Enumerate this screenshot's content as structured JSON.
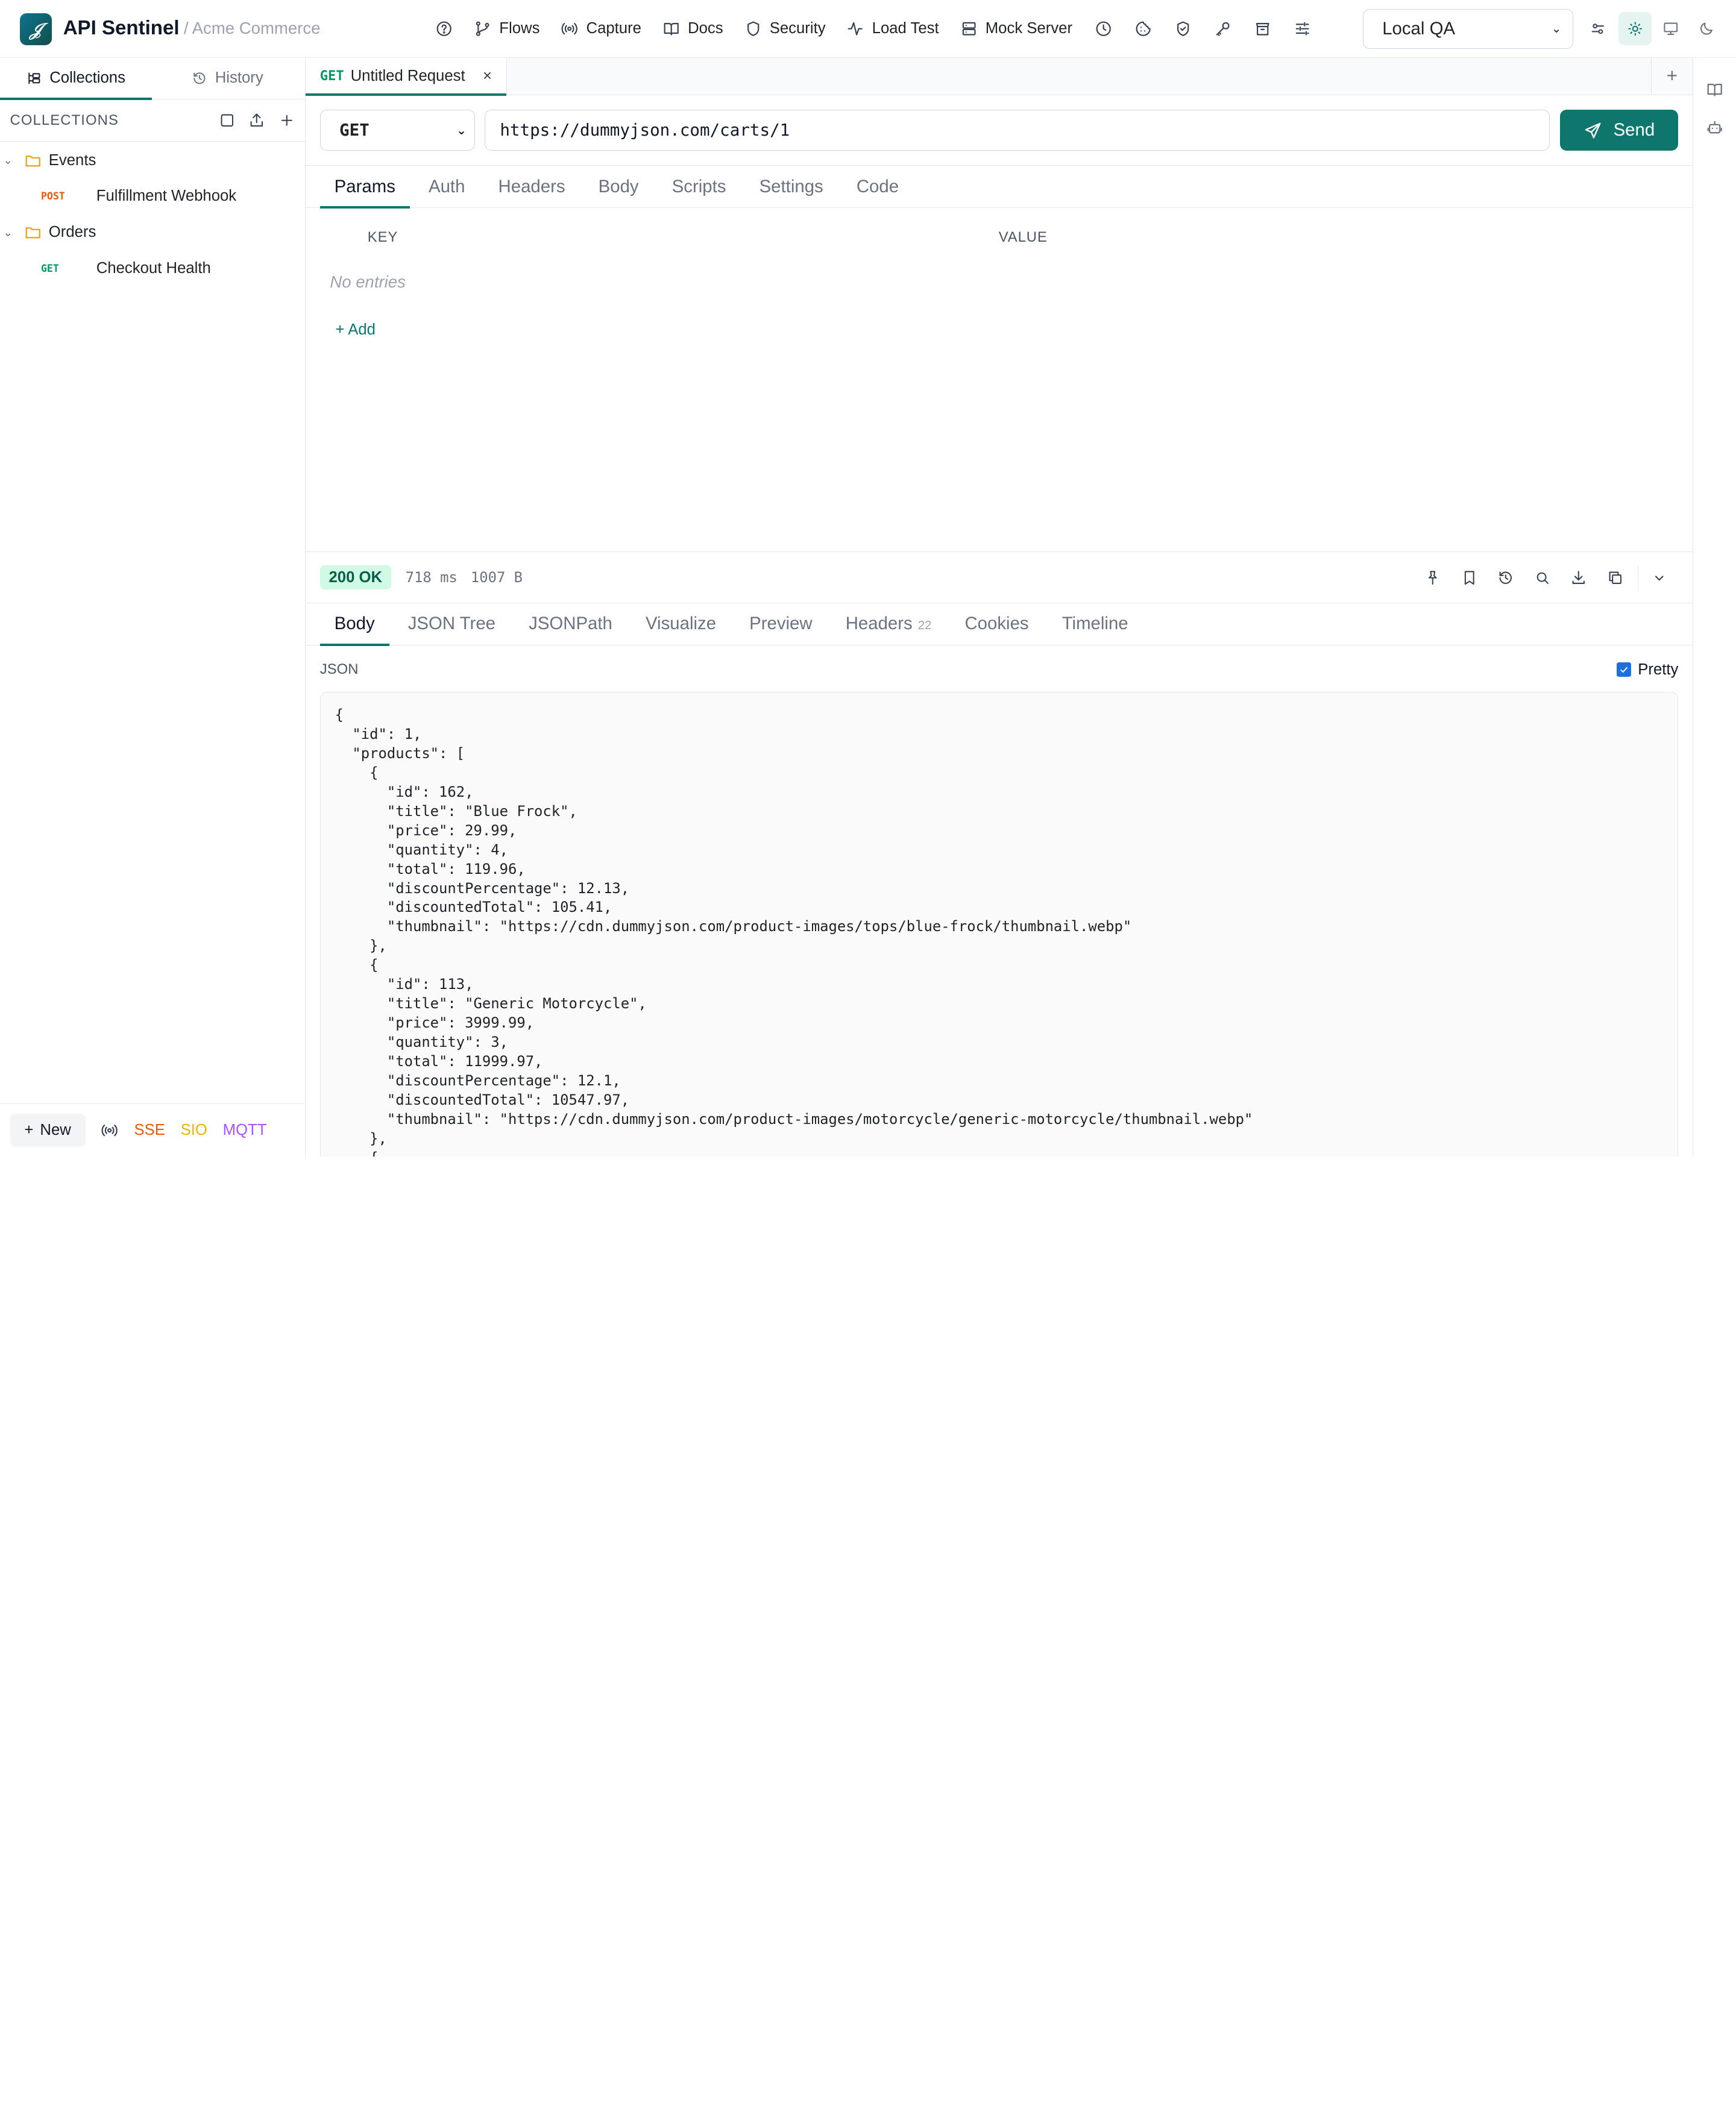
{
  "app": {
    "title": "API Sentinel",
    "workspace": "/ Acme Commerce",
    "logo_glyph": "𝒥"
  },
  "nav": [
    {
      "label": "Flows",
      "icon": "git-branch-icon"
    },
    {
      "label": "Capture",
      "icon": "broadcast-icon"
    },
    {
      "label": "Docs",
      "icon": "book-icon"
    },
    {
      "label": "Security",
      "icon": "shield-icon"
    },
    {
      "label": "Load Test",
      "icon": "activity-icon"
    },
    {
      "label": "Mock Server",
      "icon": "server-icon"
    }
  ],
  "environment": {
    "selected": "Local QA"
  },
  "sidebar": {
    "tabs": [
      {
        "label": "Collections"
      },
      {
        "label": "History"
      }
    ],
    "collections_title": "COLLECTIONS",
    "folders": [
      {
        "name": "Events",
        "requests": [
          {
            "method": "POST",
            "name": "Fulfillment Webhook"
          }
        ]
      },
      {
        "name": "Orders",
        "requests": [
          {
            "method": "GET",
            "name": "Checkout Health"
          }
        ]
      }
    ],
    "footer": {
      "new_label": "New",
      "sse": "SSE",
      "sio": "SIO",
      "mqtt": "MQTT"
    }
  },
  "request_tab": {
    "method": "GET",
    "name": "Untitled Request",
    "close": "×"
  },
  "request": {
    "method": "GET",
    "url": "https://dummyjson.com/carts/1",
    "send_label": "Send"
  },
  "request_tabs": [
    "Params",
    "Auth",
    "Headers",
    "Body",
    "Scripts",
    "Settings",
    "Code"
  ],
  "params": {
    "key_header": "KEY",
    "value_header": "VALUE",
    "empty": "No entries",
    "add": "+ Add"
  },
  "response": {
    "status": "200 OK",
    "time": "718 ms",
    "size": "1007 B",
    "tabs": [
      {
        "label": "Body",
        "count": ""
      },
      {
        "label": "JSON Tree",
        "count": ""
      },
      {
        "label": "JSONPath",
        "count": ""
      },
      {
        "label": "Visualize",
        "count": ""
      },
      {
        "label": "Preview",
        "count": ""
      },
      {
        "label": "Headers",
        "count": "22"
      },
      {
        "label": "Cookies",
        "count": ""
      },
      {
        "label": "Timeline",
        "count": ""
      }
    ],
    "format_label": "JSON",
    "pretty_label": "Pretty",
    "pretty_checked": true,
    "body_lines": [
      "{",
      "  \"id\": 1,",
      "  \"products\": [",
      "    {",
      "      \"id\": 162,",
      "      \"title\": \"Blue Frock\",",
      "      \"price\": 29.99,",
      "      \"quantity\": 4,",
      "      \"total\": 119.96,",
      "      \"discountPercentage\": 12.13,",
      "      \"discountedTotal\": 105.41,",
      "      \"thumbnail\": \"https://cdn.dummyjson.com/product-images/tops/blue-frock/thumbnail.webp\"",
      "    },",
      "    {",
      "      \"id\": 113,",
      "      \"title\": \"Generic Motorcycle\",",
      "      \"price\": 3999.99,",
      "      \"quantity\": 3,",
      "      \"total\": 11999.97,",
      "      \"discountPercentage\": 12.1,",
      "      \"discountedTotal\": 10547.97,",
      "      \"thumbnail\": \"https://cdn.dummyjson.com/product-images/motorcycle/generic-motorcycle/thumbnail.webp\"",
      "    },",
      "    {"
    ]
  },
  "colors": {
    "accent": "#0f766e",
    "post": "#ea580c",
    "get": "#059669",
    "sse": "#ea580c",
    "sio": "#eab308",
    "mqtt": "#a855f7"
  }
}
